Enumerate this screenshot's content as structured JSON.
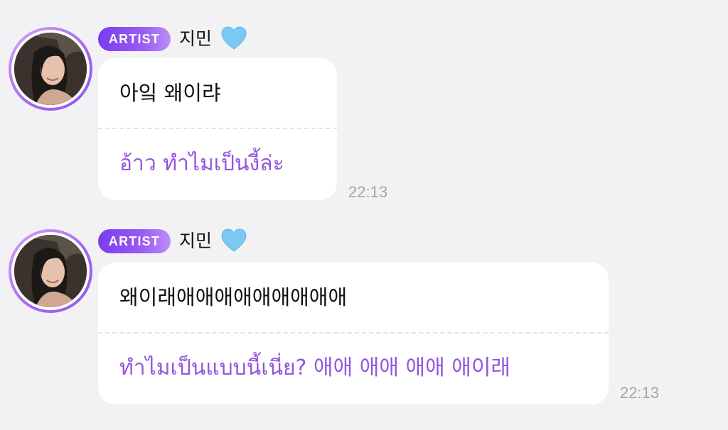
{
  "messages": [
    {
      "badge": "ARTIST",
      "sender": "지민",
      "text": "아잌 왜이랴",
      "translation": "อ้าว ทำไมเป็นงี้ล่ะ",
      "time": "22:13"
    },
    {
      "badge": "ARTIST",
      "sender": "지민",
      "text": "왜이래애애애애애애애애애",
      "translation": "ทำไมเป็นแบบนี้เนี่ย? 애애 애애 애애 애이래",
      "time": "22:13"
    }
  ],
  "colors": {
    "background": "#f2f2f4",
    "bubble": "#ffffff",
    "badge": "#8a4cf2",
    "translation_text": "#9256e0",
    "timestamp": "#a5a5aa",
    "heart": "#7cc8f4"
  },
  "icons": {
    "heart": "blue-heart-icon",
    "avatar": "avatar-photo"
  }
}
